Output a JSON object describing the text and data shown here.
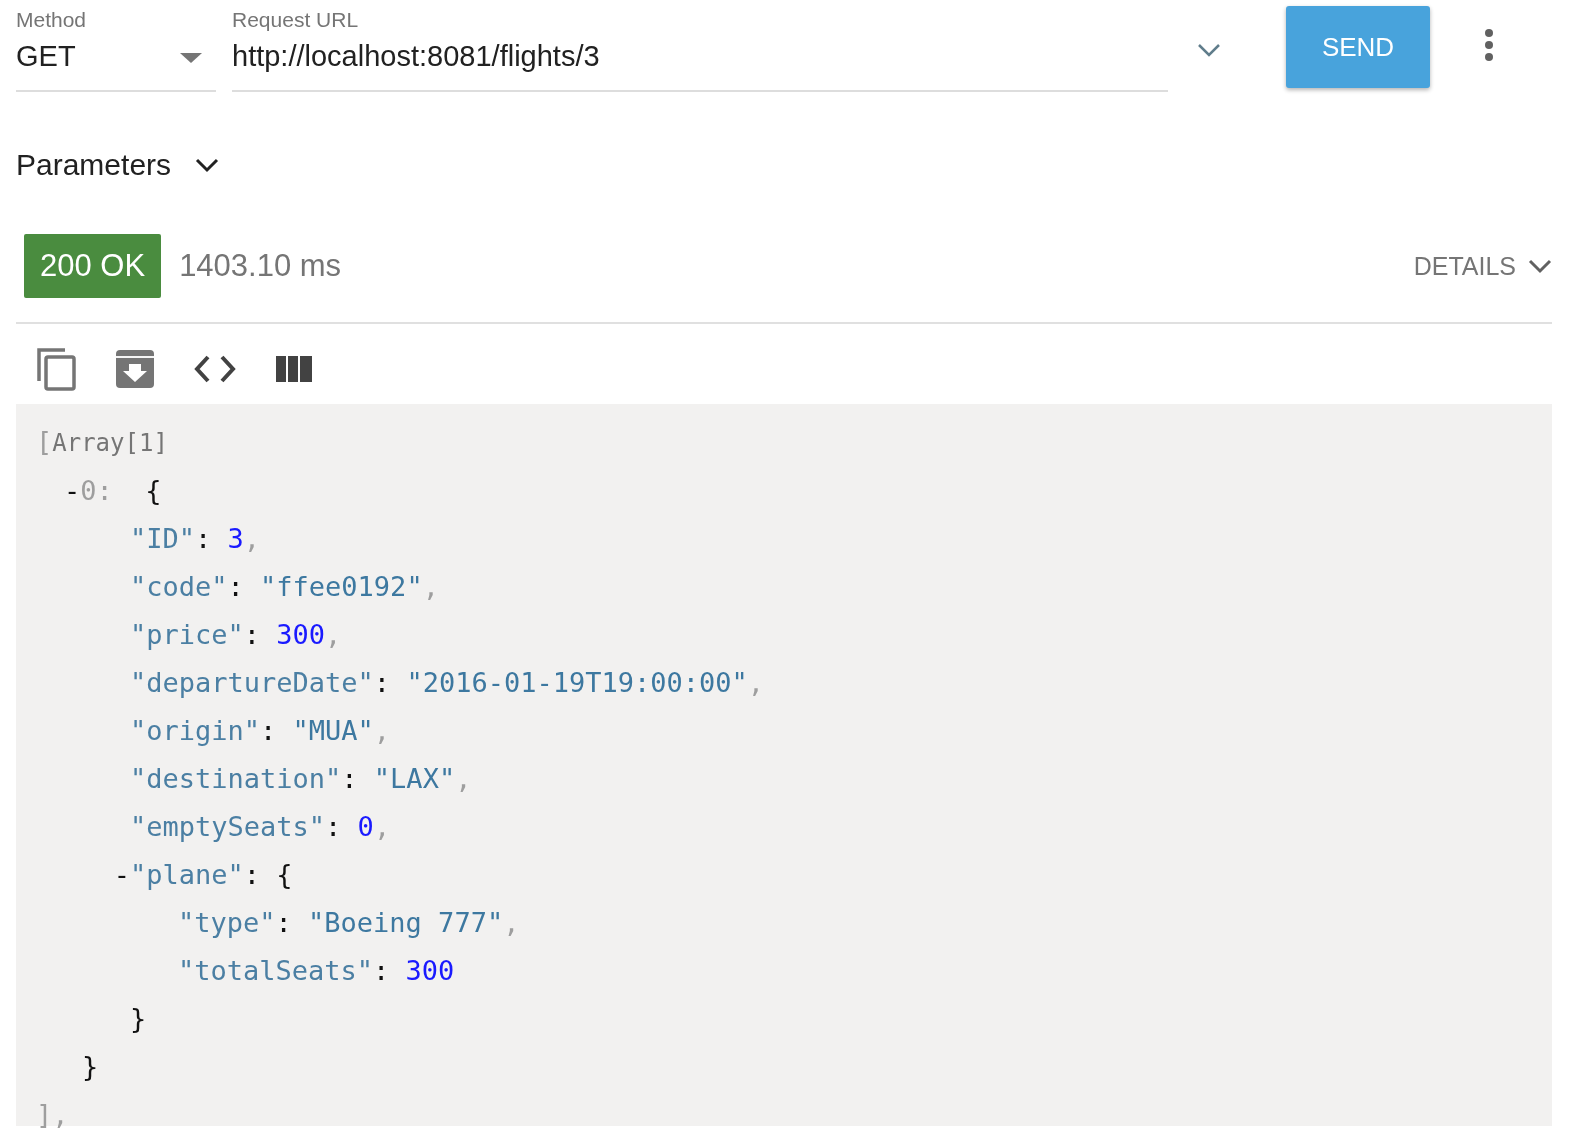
{
  "request": {
    "method": {
      "label": "Method",
      "value": "GET"
    },
    "url": {
      "label": "Request URL",
      "value": "http://localhost:8081/flights/3"
    },
    "send": "SEND"
  },
  "parameters": {
    "label": "Parameters",
    "expanded": false
  },
  "response": {
    "status": "200 OK",
    "time": "1403.10 ms",
    "details": "DETAILS"
  },
  "body": {
    "key_sep": ":",
    "open": "[",
    "label": "Array[1]",
    "close": "]",
    "close_sep": ",",
    "items": [
      {
        "toggle": "-",
        "key": "0:",
        "open": "{",
        "close": "}",
        "fields": [
          {
            "key": "\"ID\"",
            "value": "3",
            "kind": "number",
            "sep": ","
          },
          {
            "key": "\"code\"",
            "value": "\"ffee0192\"",
            "kind": "string",
            "sep": ","
          },
          {
            "key": "\"price\"",
            "value": "300",
            "kind": "number",
            "sep": ","
          },
          {
            "key": "\"departureDate\"",
            "value": "\"2016-01-19T19:00:00\"",
            "kind": "string",
            "sep": ","
          },
          {
            "key": "\"origin\"",
            "value": "\"MUA\"",
            "kind": "string",
            "sep": ","
          },
          {
            "key": "\"destination\"",
            "value": "\"LAX\"",
            "kind": "string",
            "sep": ","
          },
          {
            "key": "\"emptySeats\"",
            "value": "0",
            "kind": "number",
            "sep": ","
          },
          {
            "key": "\"plane\"",
            "kind": "object",
            "toggle": "-",
            "open": "{",
            "close": "}",
            "fields": [
              {
                "key": "\"type\"",
                "value": "\"Boeing 777\"",
                "kind": "string",
                "sep": ","
              },
              {
                "key": "\"totalSeats\"",
                "value": "300",
                "kind": "number"
              }
            ]
          }
        ]
      }
    ]
  }
}
